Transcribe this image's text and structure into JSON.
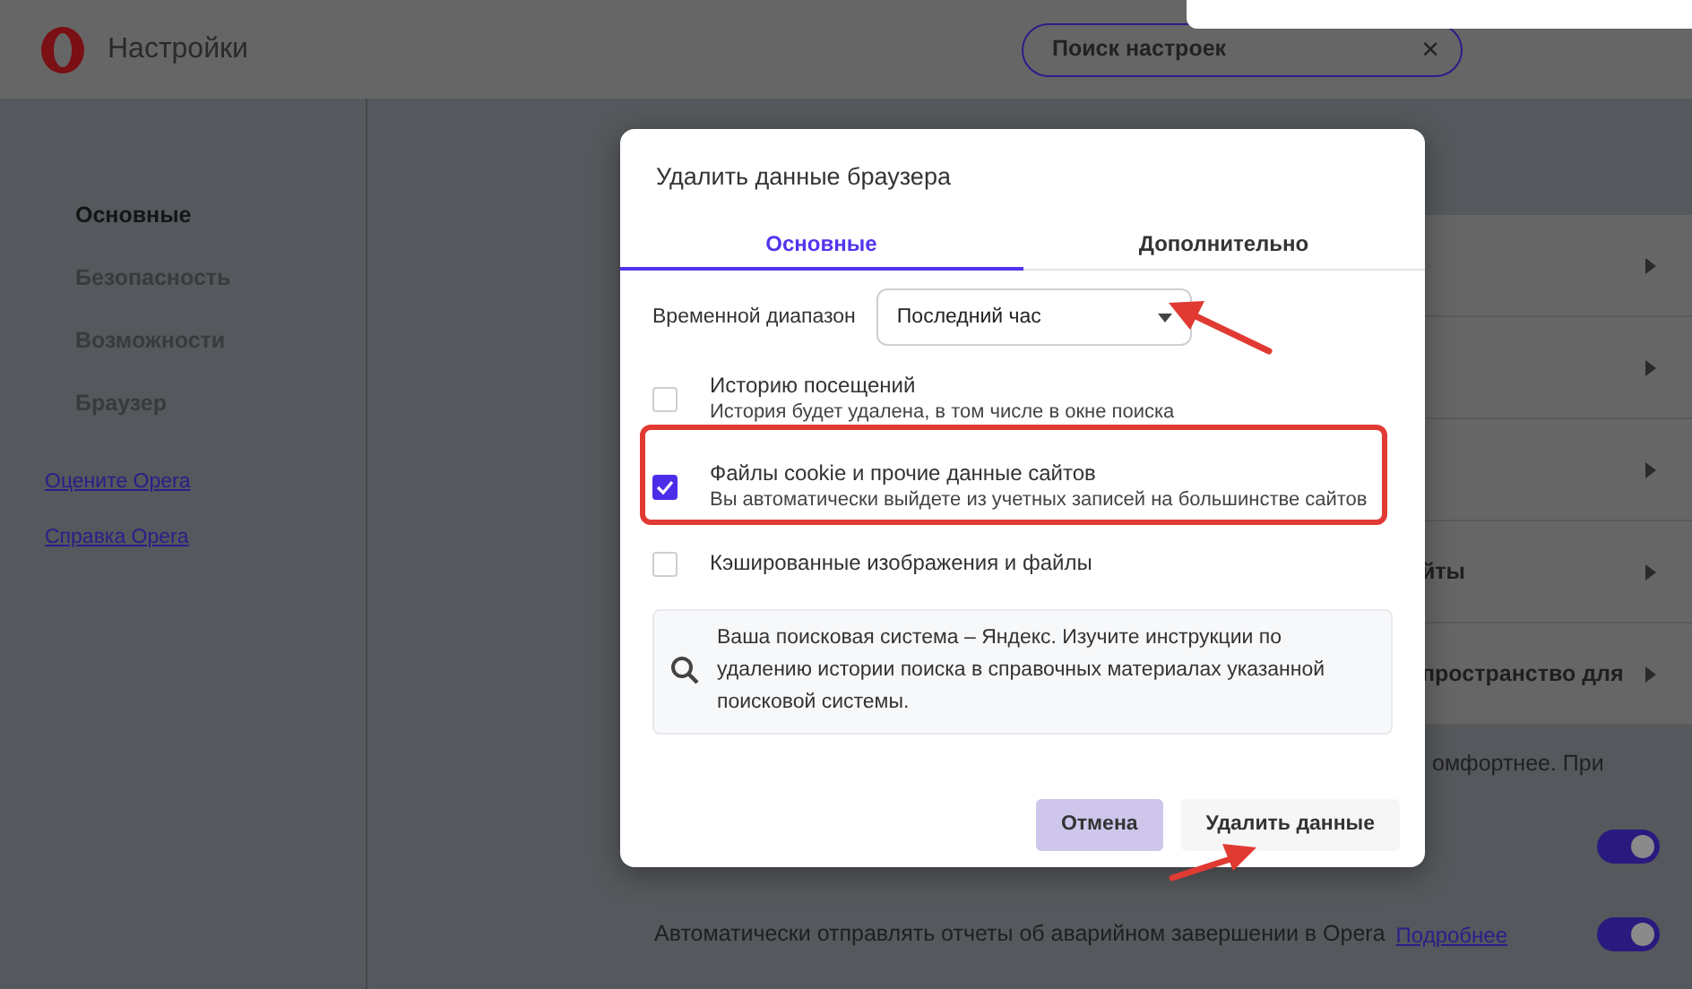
{
  "header": {
    "title": "Настройки",
    "search": {
      "placeholder": "Поиск настроек",
      "clear": "×"
    }
  },
  "sidebar": {
    "items": [
      {
        "label": "Основные",
        "selected": true
      },
      {
        "label": "Безопасность",
        "selected": false
      },
      {
        "label": "Возможности",
        "selected": false
      },
      {
        "label": "Браузер",
        "selected": false
      }
    ],
    "links": [
      "Оцените Opera",
      "Справка Opera"
    ]
  },
  "settings": {
    "rows": [
      {
        "kind": "nav"
      },
      {
        "kind": "nav"
      },
      {
        "kind": "nav"
      },
      {
        "kind": "nav",
        "text": "йты"
      },
      {
        "kind": "nav",
        "text": "пространство для"
      },
      {
        "kind": "text",
        "text": "омфортнее. При"
      },
      {
        "kind": "toggle",
        "on": true
      },
      {
        "kind": "toggle",
        "text": "Автоматически отправлять отчеты об аварийном завершении в Opera",
        "link": "Подробнее",
        "on": true
      }
    ]
  },
  "dialog": {
    "title": "Удалить данные браузера",
    "tabs": [
      {
        "label": "Основные",
        "selected": true
      },
      {
        "label": "Дополнительно",
        "selected": false
      }
    ],
    "time_range": {
      "label": "Временной диапазон",
      "value": "Последний час"
    },
    "options": [
      {
        "title": "Историю посещений",
        "description": "История будет удалена, в том числе в окне поиска",
        "checked": false
      },
      {
        "title": "Файлы cookie и прочие данные сайтов",
        "description": "Вы автоматически выйдете из учетных записей на большинстве сайтов",
        "checked": true
      },
      {
        "title": "Кэшированные изображения и файлы",
        "checked": false
      }
    ],
    "info": "Ваша поисковая система – Яндекс. Изучите инструкции по удалению истории поиска в справочных материалах указанной поисковой системы.",
    "buttons": [
      {
        "label": "Отмена",
        "kind": "cancel"
      },
      {
        "label": "Удалить данные",
        "kind": "confirm"
      }
    ]
  },
  "annotations": [
    {
      "kind": "frame"
    },
    {
      "kind": "arrow-left"
    },
    {
      "kind": "arrow-up"
    }
  ]
}
